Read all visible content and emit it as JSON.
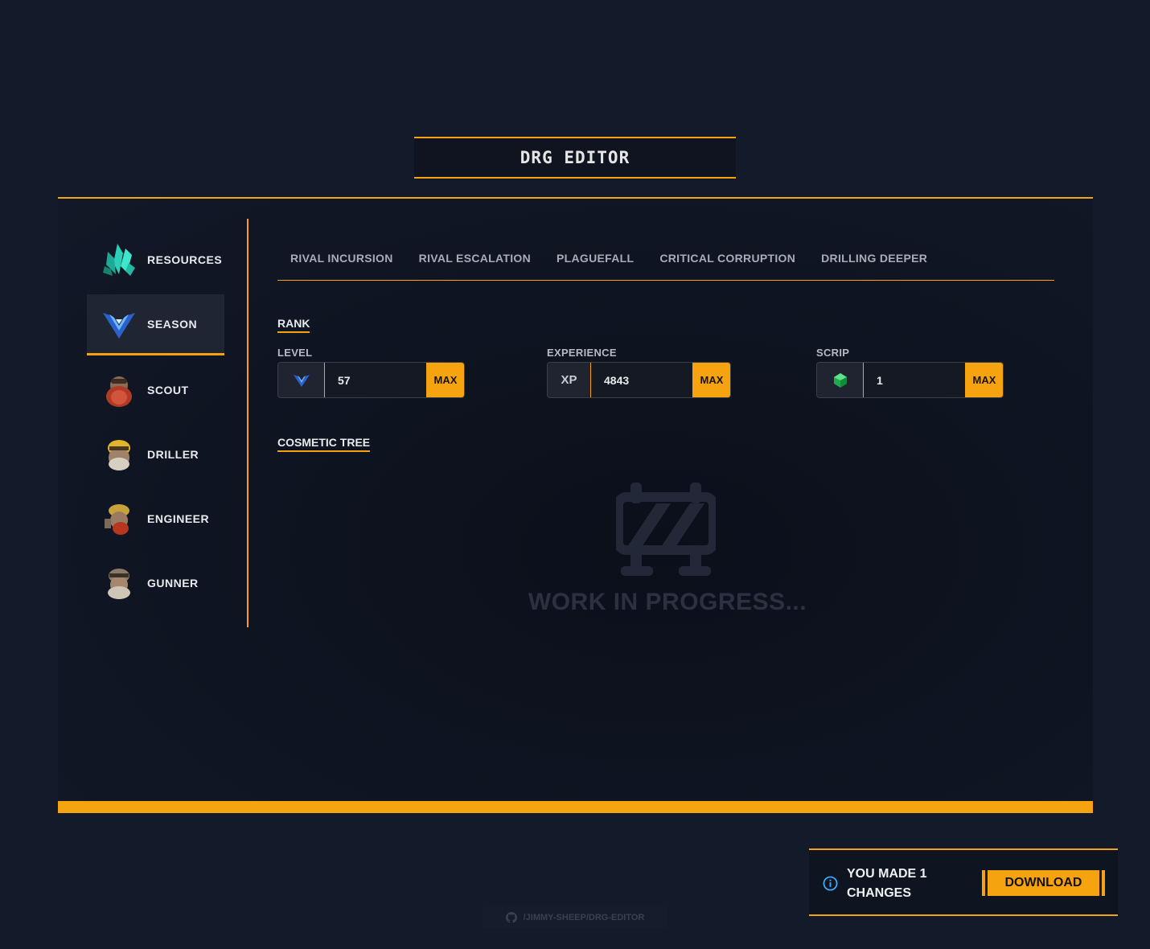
{
  "app": {
    "title": "DRG EDITOR"
  },
  "sidebar": {
    "items": [
      {
        "label": "RESOURCES",
        "icon": "crystal-icon",
        "active": false
      },
      {
        "label": "SEASON",
        "icon": "season-chevron-icon",
        "active": true
      },
      {
        "label": "SCOUT",
        "icon": "scout-portrait-icon",
        "active": false
      },
      {
        "label": "DRILLER",
        "icon": "driller-portrait-icon",
        "active": false
      },
      {
        "label": "ENGINEER",
        "icon": "engineer-portrait-icon",
        "active": false
      },
      {
        "label": "GUNNER",
        "icon": "gunner-portrait-icon",
        "active": false
      }
    ]
  },
  "tabs": [
    "RIVAL INCURSION",
    "RIVAL ESCALATION",
    "PLAGUEFALL",
    "CRITICAL CORRUPTION",
    "DRILLING DEEPER"
  ],
  "rank": {
    "heading": "RANK",
    "level": {
      "label": "LEVEL",
      "value": "57",
      "max_label": "MAX"
    },
    "experience": {
      "label": "EXPERIENCE",
      "prefix": "XP",
      "value": "4843",
      "max_label": "MAX"
    },
    "scrip": {
      "label": "SCRIP",
      "value": "1",
      "max_label": "MAX"
    }
  },
  "cosmetic": {
    "heading": "COSMETIC TREE",
    "wip_text": "WORK IN PROGRESS..."
  },
  "toast": {
    "message": "YOU MADE 1 CHANGES",
    "download_label": "DOWNLOAD"
  },
  "footer": {
    "repo_link": "/JIMMY-SHEEP/DRG-EDITOR"
  },
  "colors": {
    "accent": "#f5a40f",
    "background": "#131a2a",
    "panel": "#0e1320"
  }
}
